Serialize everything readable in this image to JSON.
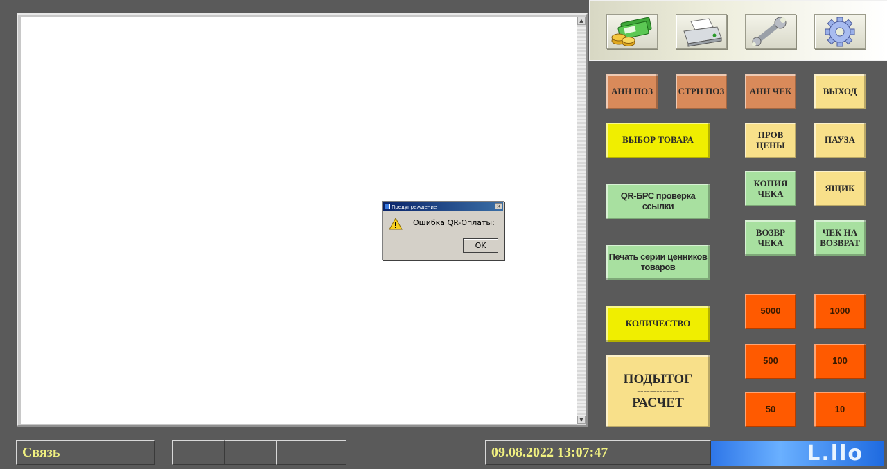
{
  "toolbar": {
    "icons": [
      "money-icon",
      "printer-icon",
      "wrench-icon",
      "gear-icon"
    ]
  },
  "buttons": {
    "ann_poz": "АНН ПОЗ",
    "strn_poz": "СТРН ПОЗ",
    "ann_chek": "АНН ЧЕК",
    "exit": "ВЫХОД",
    "select_goods": "ВЫБОР ТОВАРА",
    "check_price": "ПРОВ ЦЕНЫ",
    "pause": "ПАУЗА",
    "qr_check": "QR-БРС проверка ссылки",
    "receipt_copy": "КОПИЯ ЧЕКА",
    "drawer": "ЯЩИК",
    "return_receipt": "ВОЗВР ЧЕКА",
    "receipt_for_return": "ЧЕК НА ВОЗВРАТ",
    "print_price_tags": "Печать серии ценников товаров",
    "quantity": "КОЛИЧЕСТВО",
    "subtotal": "ПОДЫТОГ",
    "subtotal_sep": "-------------",
    "payment": "РАСЧЕТ"
  },
  "cash": [
    "5000",
    "1000",
    "500",
    "100",
    "50",
    "10"
  ],
  "status": {
    "connection": "Связь",
    "datetime": "09.08.2022 13:07:47",
    "logo_text": "L.llo"
  },
  "dialog": {
    "title": "Предупреждение",
    "message": "Ошибка QR-Оплаты:",
    "ok": "OK",
    "close": "×"
  },
  "colors": {
    "background": "#5a5a5a",
    "orange": "#d98a5a",
    "yellow": "#f8e08a",
    "bright_yellow": "#f0ee00",
    "green": "#a8e0a0",
    "cash": "#ff5a00",
    "status_text": "#f0f080"
  }
}
